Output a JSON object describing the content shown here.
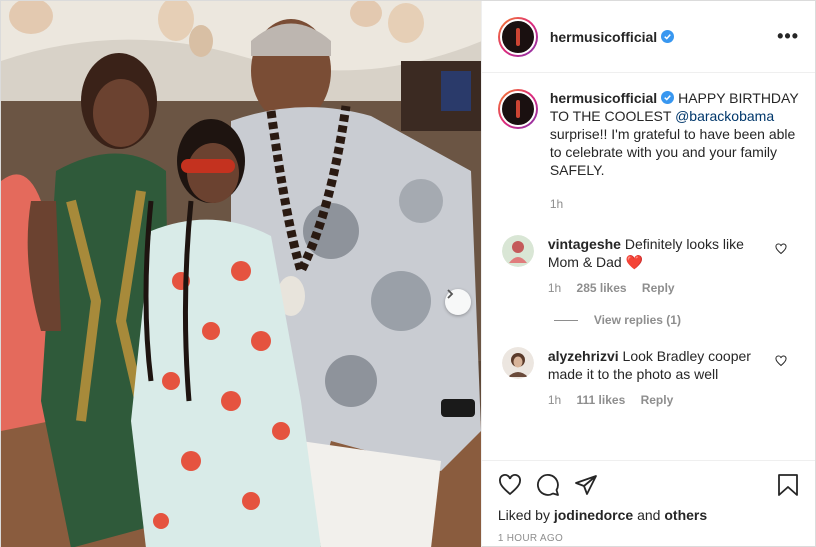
{
  "post": {
    "author": "hermusicofficial",
    "more_icon": "more-horizontal-icon"
  },
  "caption": {
    "username": "hermusicofficial",
    "text_before": " HAPPY BIRTHDAY TO THE COOLEST ",
    "mention": "@barackobama",
    "text_after": " surprise!! I'm grateful to have been able to celebrate with you and your family SAFELY.",
    "time": "1h"
  },
  "comments": [
    {
      "username": "vintageshe",
      "text": "Definitely looks like Mom & Dad",
      "emoji": "❤️",
      "time": "1h",
      "likes": "285 likes",
      "reply": "Reply"
    },
    {
      "username": "alyzehrizvi",
      "text": "Look Bradley cooper made it to the photo as well",
      "time": "1h",
      "likes": "111 likes",
      "reply": "Reply"
    }
  ],
  "view_replies": "View replies (1)",
  "likes": {
    "prefix": "Liked by ",
    "user": "jodinedorce",
    "middle": " and ",
    "others": "others"
  },
  "timestamp": "1 HOUR AGO",
  "colors": {
    "verified": "#3897f0",
    "mention": "#00376b",
    "muted": "#8e8e8e",
    "heart_emoji": "#e0245e"
  }
}
